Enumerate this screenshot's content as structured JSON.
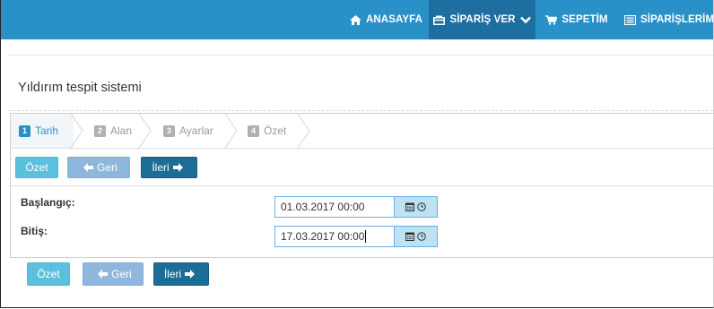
{
  "nav": {
    "home": "ANASAYFA",
    "order": "SİPARİŞ VER",
    "cart": "SEPETİM",
    "orders": "SİPARİŞLERİM"
  },
  "page": {
    "title": "Yıldırım tespit sistemi"
  },
  "wizard": {
    "steps": [
      {
        "number": "1",
        "label": "Tarih",
        "active": true
      },
      {
        "number": "2",
        "label": "Alan",
        "active": false
      },
      {
        "number": "3",
        "label": "Ayarlar",
        "active": false
      },
      {
        "number": "4",
        "label": "Özet",
        "active": false
      }
    ]
  },
  "buttons": {
    "summary": "Özet",
    "back": "Geri",
    "next": "İleri"
  },
  "form": {
    "start_label": "Başlangıç:",
    "start_value": "01.03.2017 00:00",
    "end_label": "Bitiş:",
    "end_value": "17.03.2017 00:00"
  },
  "colors": {
    "navbar": "#2a90c8",
    "navbar_active": "#1d6fa2",
    "summary_button": "#5bc0de",
    "back_button": "#8fb7de",
    "next_button": "#1b6d96"
  }
}
